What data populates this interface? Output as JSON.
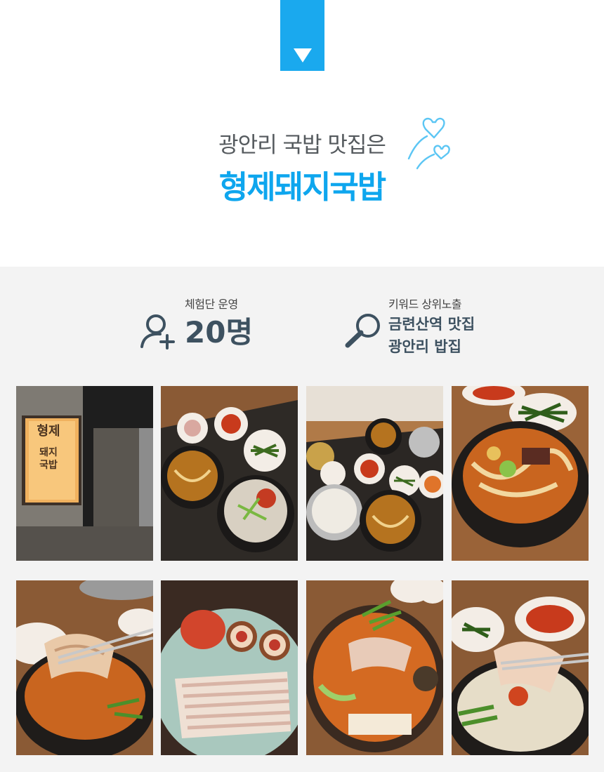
{
  "colors": {
    "accent": "#1aa9ee",
    "headline_blue": "#0ea6ee",
    "stat_text": "#3d5160",
    "section_bg": "#f3f3f3"
  },
  "marker": {
    "icon": "triangle-down-icon"
  },
  "headline": {
    "subtitle": "광안리 국밥 맛집은",
    "title": "형제돼지국밥",
    "decoration": "hearts-icon"
  },
  "stats": [
    {
      "label": "체험단 운영",
      "value": "20명",
      "icon": "user-plus-icon"
    },
    {
      "label": "키워드 상위노출",
      "value_lines": [
        "금련산역 맛집",
        "광안리 밥집"
      ],
      "icon": "search-icon"
    }
  ],
  "signboard": {
    "lines": [
      "형제",
      "돼지",
      "국밥"
    ]
  },
  "photos": [
    {
      "subject": "restaurant-signboard"
    },
    {
      "subject": "gukbap-table-set"
    },
    {
      "subject": "rice-and-side-dishes"
    },
    {
      "subject": "spicy-udon-stew"
    },
    {
      "subject": "pork-slice-lift"
    },
    {
      "subject": "boiled-pork-platter"
    },
    {
      "subject": "spicy-pork-stew-pot"
    },
    {
      "subject": "gukbap-with-chopsticks"
    }
  ]
}
